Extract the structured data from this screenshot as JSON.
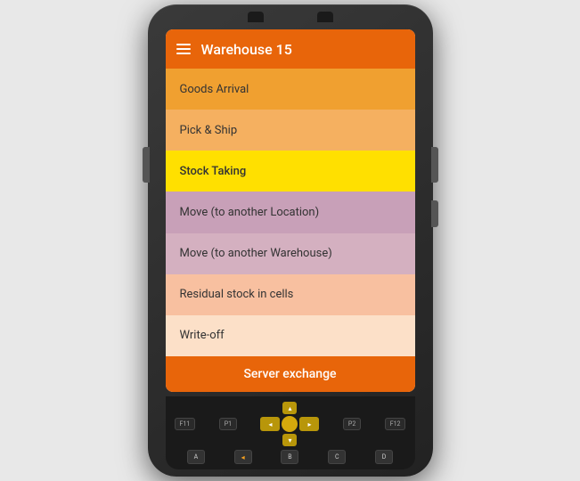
{
  "header": {
    "title": "Warehouse 15",
    "menu_icon": "hamburger"
  },
  "menu": {
    "items": [
      {
        "label": "Goods Arrival",
        "color": "#f0a030"
      },
      {
        "label": "Pick & Ship",
        "color": "#f5b060"
      },
      {
        "label": "Stock Taking",
        "color": "#ffe000"
      },
      {
        "label": "Move (to another Location)",
        "color": "#c8a0b8"
      },
      {
        "label": "Move (to another Warehouse)",
        "color": "#d4b0c0"
      },
      {
        "label": "Residual stock in cells",
        "color": "#f8c0a0"
      },
      {
        "label": "Write-off",
        "color": "#fce0c8"
      }
    ],
    "server_button": "Server exchange"
  },
  "keypad": {
    "f11": "F11",
    "f12": "F12",
    "p1": "P1",
    "p2": "P2",
    "keys": [
      "A",
      "B",
      "C",
      "D"
    ]
  }
}
